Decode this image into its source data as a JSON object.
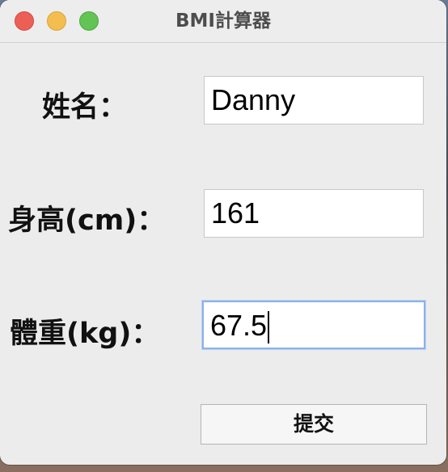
{
  "window": {
    "title": "BMI計算器"
  },
  "form": {
    "name_label": "姓名：",
    "name_value": "Danny",
    "height_label": "身高(cm)：",
    "height_value": "161",
    "weight_label": "體重(kg)：",
    "weight_value": "67.5",
    "submit_label": "提交"
  },
  "colors": {
    "close": "#ec5f57",
    "minimize": "#f4bd4f",
    "maximize": "#61c454",
    "focus_ring": "#8bb2ea"
  }
}
